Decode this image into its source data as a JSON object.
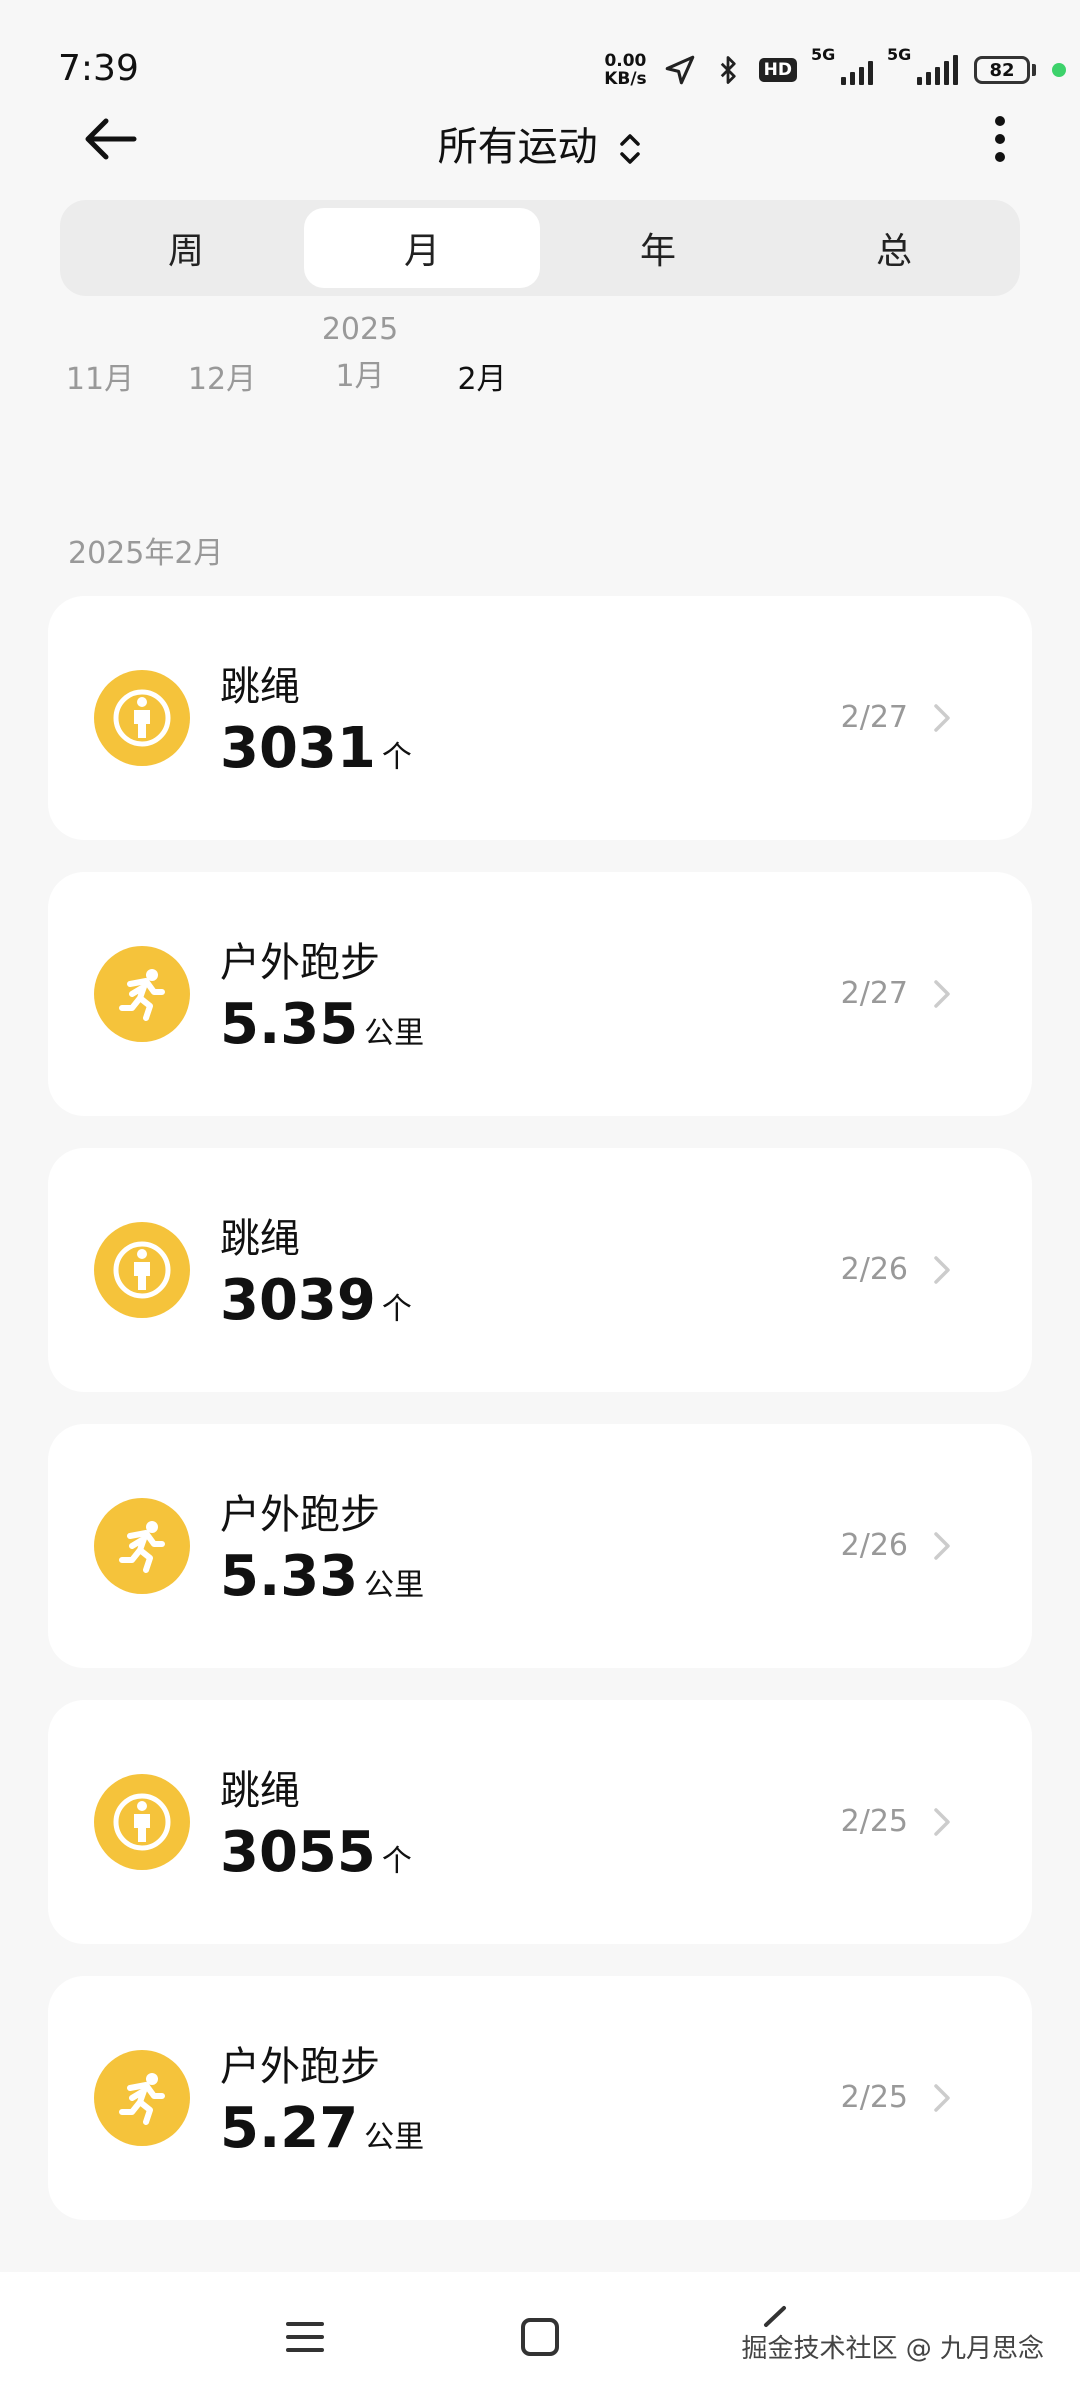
{
  "status": {
    "time": "7:39",
    "netspeed_value": "0.00",
    "netspeed_unit": "KB/s",
    "hd": "HD",
    "sig1": "5G",
    "sig2": "5G",
    "battery": "82"
  },
  "header": {
    "title": "所有运动"
  },
  "tabs": [
    "周",
    "月",
    "年",
    "总"
  ],
  "months": {
    "year": "2025",
    "items": [
      "11月",
      "12月",
      "1月",
      "2月"
    ]
  },
  "section_label": "2025年2月",
  "activities": [
    {
      "name": "跳绳",
      "value": "3031",
      "unit": "个",
      "date": "2/27",
      "icon": "jump-rope-icon"
    },
    {
      "name": "户外跑步",
      "value": "5.35",
      "unit": "公里",
      "date": "2/27",
      "icon": "running-icon"
    },
    {
      "name": "跳绳",
      "value": "3039",
      "unit": "个",
      "date": "2/26",
      "icon": "jump-rope-icon"
    },
    {
      "name": "户外跑步",
      "value": "5.33",
      "unit": "公里",
      "date": "2/26",
      "icon": "running-icon"
    },
    {
      "name": "跳绳",
      "value": "3055",
      "unit": "个",
      "date": "2/25",
      "icon": "jump-rope-icon"
    },
    {
      "name": "户外跑步",
      "value": "5.27",
      "unit": "公里",
      "date": "2/25",
      "icon": "running-icon"
    }
  ],
  "watermark": "掘金技术社区 @ 九月思念",
  "colors": {
    "accent": "#f5c33b",
    "background": "#f7f7f7",
    "card": "#ffffff"
  }
}
